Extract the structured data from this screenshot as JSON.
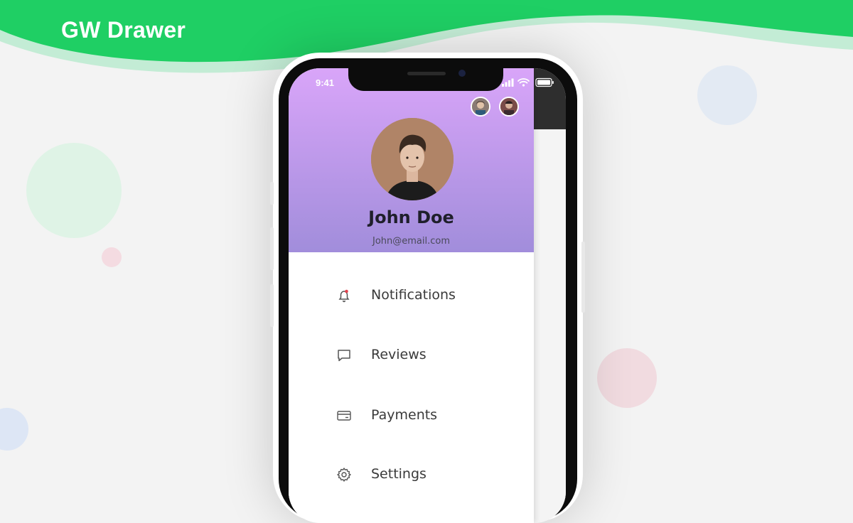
{
  "brand": {
    "title": "GW Drawer"
  },
  "colors": {
    "wave": "#1fcf64",
    "header_top": "#d9a5f9",
    "header_bottom": "#a18ddb",
    "notification_dot": "#e5424d"
  },
  "status_bar": {
    "time": "9:41",
    "icons": [
      "signal-icon",
      "wifi-icon",
      "battery-icon"
    ]
  },
  "drawer": {
    "profile": {
      "name": "John Doe",
      "email": "John@email.com"
    },
    "menu": [
      {
        "label": "Notifications",
        "icon": "bell-icon"
      },
      {
        "label": "Reviews",
        "icon": "chat-bubble-icon"
      },
      {
        "label": "Payments",
        "icon": "credit-card-icon"
      },
      {
        "label": "Settings",
        "icon": "gear-icon"
      }
    ]
  }
}
